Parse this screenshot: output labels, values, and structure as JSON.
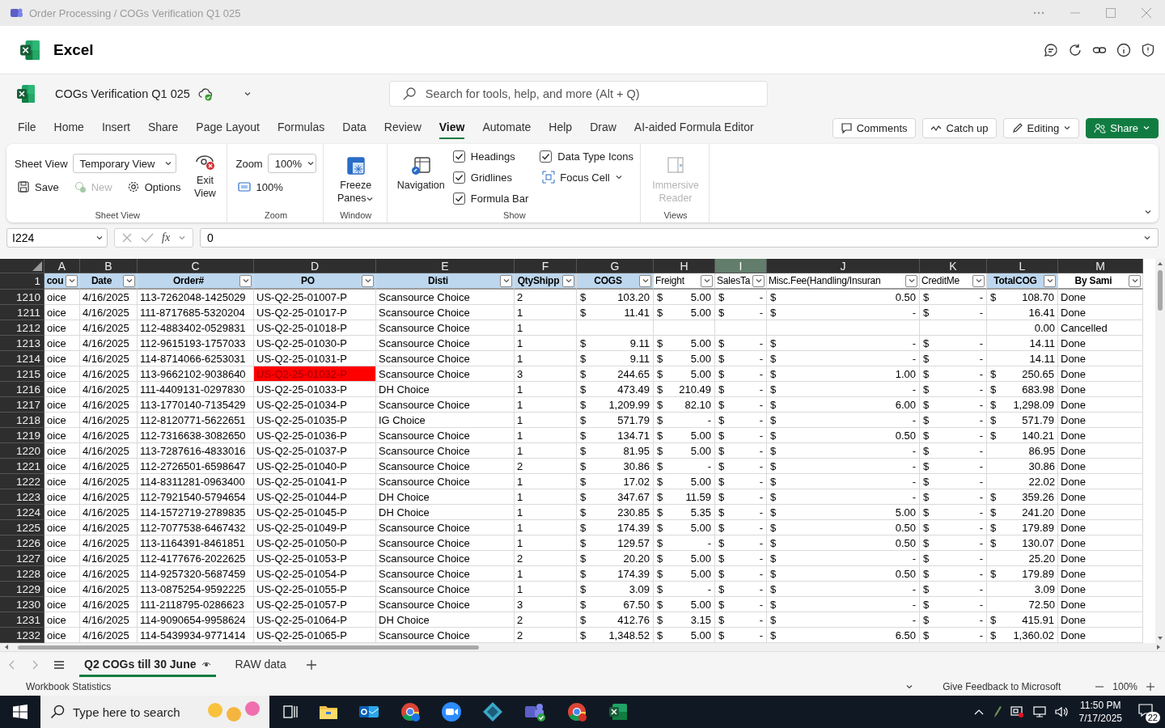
{
  "window": {
    "title": "Order Processing / COGs Verification Q1 025"
  },
  "app": {
    "name": "Excel"
  },
  "document": {
    "name": "COGs Verification Q1 025",
    "search_placeholder": "Search for tools, help, and more (Alt + Q)"
  },
  "menu_tabs": [
    {
      "label": "File",
      "selected": false
    },
    {
      "label": "Home",
      "selected": false
    },
    {
      "label": "Insert",
      "selected": false
    },
    {
      "label": "Share",
      "selected": false
    },
    {
      "label": "Page Layout",
      "selected": false
    },
    {
      "label": "Formulas",
      "selected": false
    },
    {
      "label": "Data",
      "selected": false
    },
    {
      "label": "Review",
      "selected": false
    },
    {
      "label": "View",
      "selected": true
    },
    {
      "label": "Automate",
      "selected": false
    },
    {
      "label": "Help",
      "selected": false
    },
    {
      "label": "Draw",
      "selected": false
    },
    {
      "label": "AI-aided Formula Editor",
      "selected": false
    }
  ],
  "actions": [
    {
      "label": "Comments",
      "kind": "comments"
    },
    {
      "label": "Catch up",
      "kind": "catchup"
    },
    {
      "label": "Editing",
      "kind": "editing"
    },
    {
      "label": "Share",
      "kind": "share"
    }
  ],
  "ribbon": {
    "groups": [
      {
        "kind": "sheet_view",
        "label": "Sheet View",
        "field_label": "Sheet View",
        "field_value": "Temporary View",
        "buttons": [
          {
            "label": "Save",
            "disabled": false
          },
          {
            "label": "New",
            "disabled": true
          },
          {
            "label": "Options",
            "disabled": false
          }
        ],
        "big_button": {
          "label": "Exit View",
          "disabled": false
        }
      },
      {
        "kind": "zoom",
        "label": "Zoom",
        "field_label": "Zoom",
        "field_value": "100%",
        "buttons": [
          {
            "label": "100%",
            "disabled": false
          }
        ]
      },
      {
        "kind": "window",
        "label": "Window",
        "big_button": {
          "label": "Freeze Panes",
          "disabled": false
        }
      },
      {
        "kind": "show",
        "label": "Show",
        "big_button": {
          "label": "Navigation",
          "disabled": false
        },
        "checkboxes": [
          {
            "label": "Headings",
            "checked": true
          },
          {
            "label": "Gridlines",
            "checked": true
          },
          {
            "label": "Formula Bar",
            "checked": true
          },
          {
            "label": "Data Type Icons",
            "checked": true
          }
        ],
        "buttons": [
          {
            "label": "Focus Cell",
            "disabled": false
          }
        ]
      },
      {
        "kind": "views",
        "label": "Views",
        "big_button": {
          "label": "Immersive Reader",
          "disabled": true
        }
      }
    ]
  },
  "formula_bar": {
    "name_box": "I224",
    "function_label": "fx",
    "value": "0"
  },
  "sheet": {
    "columns": [
      {
        "label": "A",
        "selected": false
      },
      {
        "label": "B",
        "selected": false
      },
      {
        "label": "C",
        "selected": false
      },
      {
        "label": "D",
        "selected": false
      },
      {
        "label": "E",
        "selected": false
      },
      {
        "label": "F",
        "selected": false
      },
      {
        "label": "G",
        "selected": false
      },
      {
        "label": "H",
        "selected": false
      },
      {
        "label": "I",
        "selected": true
      },
      {
        "label": "J",
        "selected": false
      },
      {
        "label": "K",
        "selected": false
      },
      {
        "label": "L",
        "selected": false
      },
      {
        "label": "M",
        "selected": false
      }
    ],
    "header_row_number": "1",
    "headers": [
      {
        "label": "cou",
        "kind": "blue"
      },
      {
        "label": "Date",
        "kind": "blue"
      },
      {
        "label": "Order#",
        "kind": "blue"
      },
      {
        "label": "PO",
        "kind": "blue"
      },
      {
        "label": "Disti",
        "kind": "blue"
      },
      {
        "label": "QtyShipp",
        "kind": "blue"
      },
      {
        "label": "COGS",
        "kind": "blue"
      },
      {
        "label": "Freight",
        "kind": "plain"
      },
      {
        "label": "SalesTa",
        "kind": "plain"
      },
      {
        "label": "Misc.Fee(Handling/Insuran",
        "kind": "plain"
      },
      {
        "label": "CreditMe",
        "kind": "plain"
      },
      {
        "label": "TotalCOG",
        "kind": "blue"
      },
      {
        "label": "By Sami",
        "kind": "bold"
      }
    ],
    "rows": [
      {
        "number": "1210",
        "flagged": false,
        "cells": [
          "oice",
          "4/16/2025",
          "113-7262048-1425029",
          "US-Q2-25-01007-P",
          "Scansource Choice",
          "2",
          [
            "$",
            "103.20"
          ],
          [
            "$",
            "5.00"
          ],
          [
            "$",
            "-"
          ],
          [
            "$",
            "0.50"
          ],
          [
            "$",
            "-"
          ],
          [
            "$",
            "108.70"
          ],
          "Done"
        ]
      },
      {
        "number": "1211",
        "flagged": false,
        "cells": [
          "oice",
          "4/16/2025",
          "111-8717685-5320204",
          "US-Q2-25-01017-P",
          "Scansource Choice",
          "1",
          [
            "$",
            "11.41"
          ],
          [
            "$",
            "5.00"
          ],
          [
            "$",
            "-"
          ],
          [
            "$",
            "-"
          ],
          [
            "$",
            "-"
          ],
          "16.41",
          "Done"
        ]
      },
      {
        "number": "1212",
        "flagged": false,
        "cells": [
          "oice",
          "4/16/2025",
          "112-4883402-0529831",
          "US-Q2-25-01018-P",
          "Scansource Choice",
          "1",
          null,
          null,
          null,
          null,
          null,
          "0.00",
          "Cancelled"
        ]
      },
      {
        "number": "1213",
        "flagged": false,
        "cells": [
          "oice",
          "4/16/2025",
          "112-9615193-1757033",
          "US-Q2-25-01030-P",
          "Scansource Choice",
          "1",
          [
            "$",
            "9.11"
          ],
          [
            "$",
            "5.00"
          ],
          [
            "$",
            "-"
          ],
          [
            "$",
            "-"
          ],
          [
            "$",
            "-"
          ],
          "14.11",
          "Done"
        ]
      },
      {
        "number": "1214",
        "flagged": false,
        "cells": [
          "oice",
          "4/16/2025",
          "114-8714066-6253031",
          "US-Q2-25-01031-P",
          "Scansource Choice",
          "1",
          [
            "$",
            "9.11"
          ],
          [
            "$",
            "5.00"
          ],
          [
            "$",
            "-"
          ],
          [
            "$",
            "-"
          ],
          [
            "$",
            "-"
          ],
          "14.11",
          "Done"
        ]
      },
      {
        "number": "1215",
        "flagged": true,
        "cells": [
          "oice",
          "4/16/2025",
          "113-9662102-9038640",
          "US-Q2-25-01032-P",
          "Scansource Choice",
          "3",
          [
            "$",
            "244.65"
          ],
          [
            "$",
            "5.00"
          ],
          [
            "$",
            "-"
          ],
          [
            "$",
            "1.00"
          ],
          [
            "$",
            "-"
          ],
          [
            "$",
            "250.65"
          ],
          "Done"
        ]
      },
      {
        "number": "1216",
        "flagged": false,
        "cells": [
          "oice",
          "4/16/2025",
          "111-4409131-0297830",
          "US-Q2-25-01033-P",
          "DH Choice",
          "1",
          [
            "$",
            "473.49"
          ],
          [
            "$",
            "210.49"
          ],
          [
            "$",
            "-"
          ],
          [
            "$",
            "-"
          ],
          [
            "$",
            "-"
          ],
          [
            "$",
            "683.98"
          ],
          "Done"
        ]
      },
      {
        "number": "1217",
        "flagged": false,
        "cells": [
          "oice",
          "4/16/2025",
          "113-1770140-7135429",
          "US-Q2-25-01034-P",
          "Scansource Choice",
          "1",
          [
            "$",
            "1,209.99"
          ],
          [
            "$",
            "82.10"
          ],
          [
            "$",
            "-"
          ],
          [
            "$",
            "6.00"
          ],
          [
            "$",
            "-"
          ],
          [
            "$",
            "1,298.09"
          ],
          "Done"
        ]
      },
      {
        "number": "1218",
        "flagged": false,
        "cells": [
          "oice",
          "4/16/2025",
          "112-8120771-5622651",
          "US-Q2-25-01035-P",
          "IG Choice",
          "1",
          [
            "$",
            "571.79"
          ],
          [
            "$",
            "-"
          ],
          [
            "$",
            "-"
          ],
          [
            "$",
            "-"
          ],
          [
            "$",
            "-"
          ],
          [
            "$",
            "571.79"
          ],
          "Done"
        ]
      },
      {
        "number": "1219",
        "flagged": false,
        "cells": [
          "oice",
          "4/16/2025",
          "112-7316638-3082650",
          "US-Q2-25-01036-P",
          "Scansource Choice",
          "1",
          [
            "$",
            "134.71"
          ],
          [
            "$",
            "5.00"
          ],
          [
            "$",
            "-"
          ],
          [
            "$",
            "0.50"
          ],
          [
            "$",
            "-"
          ],
          [
            "$",
            "140.21"
          ],
          "Done"
        ]
      },
      {
        "number": "1220",
        "flagged": false,
        "cells": [
          "oice",
          "4/16/2025",
          "113-7287616-4833016",
          "US-Q2-25-01037-P",
          "Scansource Choice",
          "1",
          [
            "$",
            "81.95"
          ],
          [
            "$",
            "5.00"
          ],
          [
            "$",
            "-"
          ],
          [
            "$",
            "-"
          ],
          [
            "$",
            "-"
          ],
          "86.95",
          "Done"
        ]
      },
      {
        "number": "1221",
        "flagged": false,
        "cells": [
          "oice",
          "4/16/2025",
          "112-2726501-6598647",
          "US-Q2-25-01040-P",
          "Scansource Choice",
          "2",
          [
            "$",
            "30.86"
          ],
          [
            "$",
            "-"
          ],
          [
            "$",
            "-"
          ],
          [
            "$",
            "-"
          ],
          [
            "$",
            "-"
          ],
          "30.86",
          "Done"
        ]
      },
      {
        "number": "1222",
        "flagged": false,
        "cells": [
          "oice",
          "4/16/2025",
          "114-8311281-0963400",
          "US-Q2-25-01041-P",
          "Scansource Choice",
          "1",
          [
            "$",
            "17.02"
          ],
          [
            "$",
            "5.00"
          ],
          [
            "$",
            "-"
          ],
          [
            "$",
            "-"
          ],
          [
            "$",
            "-"
          ],
          "22.02",
          "Done"
        ]
      },
      {
        "number": "1223",
        "flagged": false,
        "cells": [
          "oice",
          "4/16/2025",
          "112-7921540-5794654",
          "US-Q2-25-01044-P",
          "DH Choice",
          "1",
          [
            "$",
            "347.67"
          ],
          [
            "$",
            "11.59"
          ],
          [
            "$",
            "-"
          ],
          [
            "$",
            "-"
          ],
          [
            "$",
            "-"
          ],
          [
            "$",
            "359.26"
          ],
          "Done"
        ]
      },
      {
        "number": "1224",
        "flagged": false,
        "cells": [
          "oice",
          "4/16/2025",
          "114-1572719-2789835",
          "US-Q2-25-01045-P",
          "DH Choice",
          "1",
          [
            "$",
            "230.85"
          ],
          [
            "$",
            "5.35"
          ],
          [
            "$",
            "-"
          ],
          [
            "$",
            "5.00"
          ],
          [
            "$",
            "-"
          ],
          [
            "$",
            "241.20"
          ],
          "Done"
        ]
      },
      {
        "number": "1225",
        "flagged": false,
        "cells": [
          "oice",
          "4/16/2025",
          "112-7077538-6467432",
          "US-Q2-25-01049-P",
          "Scansource Choice",
          "1",
          [
            "$",
            "174.39"
          ],
          [
            "$",
            "5.00"
          ],
          [
            "$",
            "-"
          ],
          [
            "$",
            "0.50"
          ],
          [
            "$",
            "-"
          ],
          [
            "$",
            "179.89"
          ],
          "Done"
        ]
      },
      {
        "number": "1226",
        "flagged": false,
        "cells": [
          "oice",
          "4/16/2025",
          "113-1164391-8461851",
          "US-Q2-25-01050-P",
          "Scansource Choice",
          "1",
          [
            "$",
            "129.57"
          ],
          [
            "$",
            "-"
          ],
          [
            "$",
            "-"
          ],
          [
            "$",
            "0.50"
          ],
          [
            "$",
            "-"
          ],
          [
            "$",
            "130.07"
          ],
          "Done"
        ]
      },
      {
        "number": "1227",
        "flagged": false,
        "cells": [
          "oice",
          "4/16/2025",
          "112-4177676-2022625",
          "US-Q2-25-01053-P",
          "Scansource Choice",
          "2",
          [
            "$",
            "20.20"
          ],
          [
            "$",
            "5.00"
          ],
          [
            "$",
            "-"
          ],
          [
            "$",
            "-"
          ],
          [
            "$",
            "-"
          ],
          "25.20",
          "Done"
        ]
      },
      {
        "number": "1228",
        "flagged": false,
        "cells": [
          "oice",
          "4/16/2025",
          "114-9257320-5687459",
          "US-Q2-25-01054-P",
          "Scansource Choice",
          "1",
          [
            "$",
            "174.39"
          ],
          [
            "$",
            "5.00"
          ],
          [
            "$",
            "-"
          ],
          [
            "$",
            "0.50"
          ],
          [
            "$",
            "-"
          ],
          [
            "$",
            "179.89"
          ],
          "Done"
        ]
      },
      {
        "number": "1229",
        "flagged": false,
        "cells": [
          "oice",
          "4/16/2025",
          "113-0875254-9592225",
          "US-Q2-25-01055-P",
          "Scansource Choice",
          "1",
          [
            "$",
            "3.09"
          ],
          [
            "$",
            "-"
          ],
          [
            "$",
            "-"
          ],
          [
            "$",
            "-"
          ],
          [
            "$",
            "-"
          ],
          "3.09",
          "Done"
        ]
      },
      {
        "number": "1230",
        "flagged": false,
        "cells": [
          "oice",
          "4/16/2025",
          "111-2118795-0286623",
          "US-Q2-25-01057-P",
          "Scansource Choice",
          "3",
          [
            "$",
            "67.50"
          ],
          [
            "$",
            "5.00"
          ],
          [
            "$",
            "-"
          ],
          [
            "$",
            "-"
          ],
          [
            "$",
            "-"
          ],
          "72.50",
          "Done"
        ]
      },
      {
        "number": "1231",
        "flagged": false,
        "cells": [
          "oice",
          "4/16/2025",
          "114-9090654-9958624",
          "US-Q2-25-01064-P",
          "DH Choice",
          "2",
          [
            "$",
            "412.76"
          ],
          [
            "$",
            "3.15"
          ],
          [
            "$",
            "-"
          ],
          [
            "$",
            "-"
          ],
          [
            "$",
            "-"
          ],
          [
            "$",
            "415.91"
          ],
          "Done"
        ]
      },
      {
        "number": "1232",
        "flagged": false,
        "cells": [
          "oice",
          "4/16/2025",
          "114-5439934-9771414",
          "US-Q2-25-01065-P",
          "Scansource Choice",
          "2",
          [
            "$",
            "1,348.52"
          ],
          [
            "$",
            "5.00"
          ],
          [
            "$",
            "-"
          ],
          [
            "$",
            "6.50"
          ],
          [
            "$",
            "-"
          ],
          [
            "$",
            "1,360.02"
          ],
          "Done"
        ]
      }
    ]
  },
  "sheet_tabs": [
    {
      "label": "Q2 COGs till 30 June",
      "selected": true
    },
    {
      "label": "RAW data",
      "selected": false
    }
  ],
  "status_bar": {
    "statistics": "Workbook Statistics",
    "feedback": "Give Feedback to Microsoft",
    "zoom": "100%"
  },
  "taskbar": {
    "search_placeholder": "Type here to search",
    "time": "11:50 PM",
    "date": "7/17/2025",
    "notifications": "22"
  }
}
